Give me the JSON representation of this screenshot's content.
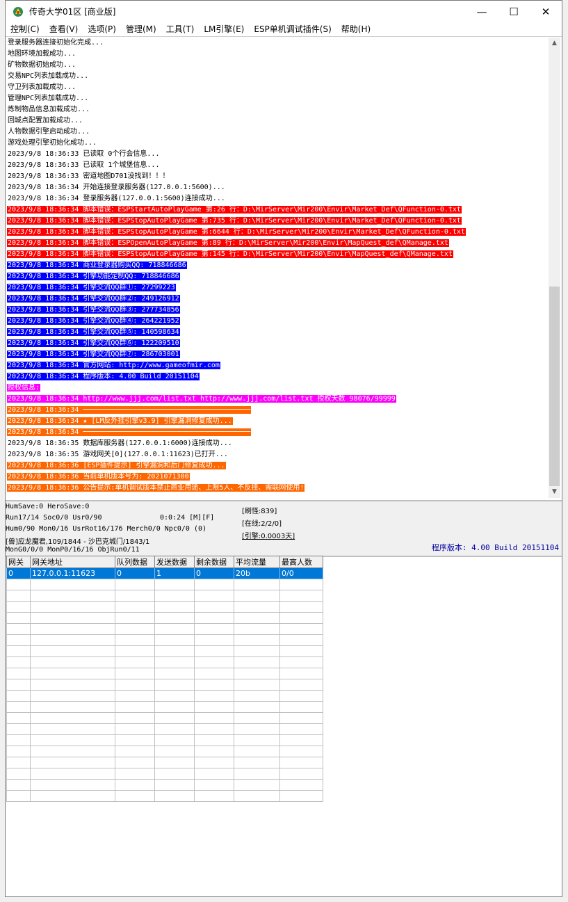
{
  "window": {
    "title": "传奇大学01区 [商业版]",
    "controls": {
      "minimize": "—",
      "maximize": "☐",
      "close": "✕"
    }
  },
  "menu": [
    "控制(C)",
    "查看(V)",
    "选项(P)",
    "管理(M)",
    "工具(T)",
    "LM引擎(E)",
    "ESP单机调试插件(S)",
    "帮助(H)"
  ],
  "log": [
    {
      "text": "登录服务器连接初始化完成...",
      "style": "black"
    },
    {
      "text": "地图环境加载成功...",
      "style": "black"
    },
    {
      "text": "矿物数据初始成功...",
      "style": "black"
    },
    {
      "text": "交易NPC列表加载成功...",
      "style": "black"
    },
    {
      "text": "守卫列表加载成功...",
      "style": "black"
    },
    {
      "text": "管理NPC列表加载成功...",
      "style": "black"
    },
    {
      "text": "炼制物品信息加载成功...",
      "style": "black"
    },
    {
      "text": "回城点配置加载成功...",
      "style": "black"
    },
    {
      "text": "人物数据引擎启动成功...",
      "style": "black"
    },
    {
      "text": "游戏处理引擎初始化成功...",
      "style": "black"
    },
    {
      "text": "2023/9/8 18:36:33 已读取 0个行会信息...",
      "style": "black"
    },
    {
      "text": "2023/9/8 18:36:33 已读取 1个城堡信息...",
      "style": "black"
    },
    {
      "text": "2023/9/8 18:36:33 密道地图D701没找到！！！",
      "style": "black"
    },
    {
      "text": "2023/9/8 18:36:34 开始连接登录服务器(127.0.0.1:5600)...",
      "style": "black"
    },
    {
      "text": "2023/9/8 18:36:34 登录服务器(127.0.0.1:5600)连接成功...",
      "style": "black"
    },
    {
      "text": "2023/9/8 18:36:34 脚本错误：ESPStartAutoPlayGame 第:26 行：D:\\MirServer\\Mir200\\Envir\\Market_Def\\QFunction-0.txt",
      "style": "red"
    },
    {
      "text": "2023/9/8 18:36:34 脚本错误：ESPStopAutoPlayGame 第:735 行：D:\\MirServer\\Mir200\\Envir\\Market_Def\\QFunction-0.txt",
      "style": "red"
    },
    {
      "text": "2023/9/8 18:36:34 脚本错误：ESPStopAutoPlayGame 第:6644 行：D:\\MirServer\\Mir200\\Envir\\Market_Def\\QFunction-0.txt",
      "style": "red"
    },
    {
      "text": "2023/9/8 18:36:34 脚本错误：ESPOpenAutoPlayGame 第:89 行：D:\\MirServer\\Mir200\\Envir\\MapQuest_def\\QManage.txt",
      "style": "red"
    },
    {
      "text": "2023/9/8 18:36:34 脚本错误：ESPStopAutoPlayGame 第:145 行：D:\\MirServer\\Mir200\\Envir\\MapQuest_def\\QManage.txt",
      "style": "red"
    },
    {
      "text": "2023/9/8 18:36:34 商业登录器购买QQ: 718846686",
      "style": "blue"
    },
    {
      "text": "2023/9/8 18:36:34 引擎功能定制QQ: 718846686",
      "style": "blue"
    },
    {
      "text": "2023/9/8 18:36:34 引擎交流QQ群①: 27299223",
      "style": "blue"
    },
    {
      "text": "2023/9/8 18:36:34 引擎交流QQ群②: 249126912",
      "style": "blue"
    },
    {
      "text": "2023/9/8 18:36:34 引擎交流QQ群③: 277734856",
      "style": "blue"
    },
    {
      "text": "2023/9/8 18:36:34 引擎交流QQ群④: 264221952",
      "style": "blue"
    },
    {
      "text": "2023/9/8 18:36:34 引擎交流QQ群⑤: 140598634",
      "style": "blue"
    },
    {
      "text": "2023/9/8 18:36:34 引擎交流QQ群⑥: 122209510",
      "style": "blue"
    },
    {
      "text": "2023/9/8 18:36:34 引擎交流QQ群⑦: 286703001",
      "style": "blue"
    },
    {
      "text": "2023/9/8 18:36:34 官方网站: http://www.gameofmir.com",
      "style": "blue"
    },
    {
      "text": "2023/9/8 18:36:34 程序版本: 4.00 Build 20151104",
      "style": "blue"
    },
    {
      "text": "授权信息:",
      "style": "magenta"
    },
    {
      "text": "2023/9/8 18:36:34 http://www.jjj.com/list.txt http://www.jjj.com/list.txt 授权天数 98076/99999",
      "style": "magenta"
    },
    {
      "text": "2023/9/8 18:36:34 ────────────────────────────────────────",
      "style": "orange"
    },
    {
      "text": "2023/9/8 18:36:34 ★ [LM反外挂引擎v3.9] 引擎漏洞修复成功...",
      "style": "orange"
    },
    {
      "text": "2023/9/8 18:36:34 ────────────────────────────────────────",
      "style": "orange"
    },
    {
      "text": "2023/9/8 18:36:35 数据库服务器(127.0.0.1:6000)连接成功...",
      "style": "black"
    },
    {
      "text": "2023/9/8 18:36:35 游戏网关[0](127.0.0.1:11623)已打开...",
      "style": "black"
    },
    {
      "text": "2023/9/8 18:36:36 [ESP插件提示] 引擎漏洞和后门修复成功...",
      "style": "orange"
    },
    {
      "text": "2023/9/8 18:36:36 当前单机版本号为: 2021071300",
      "style": "orange"
    },
    {
      "text": "2023/9/8 18:36:36 公告提示:单机调试版本禁止商业用途、上限5人、不反挂、需联网使用!",
      "style": "orange"
    }
  ],
  "status": {
    "line1": "HumSave:0 HeroSave:0",
    "line2": "Run17/14 Soc0/0 Usr0/90",
    "time": "0:0:24 [M][F]",
    "line3": "Hum0/90 Mon0/16 UsrRot16/176 Merch0/0 Npc0/0 (0)",
    "line4": "[兽]应龙魔君,109/1844 - 沙巴克城门/1843/1",
    "line5": "MonG0/0/0 MonP0/16/16 ObjRun0/11",
    "refresh": "[刷怪:839]",
    "online": "[在线:2/2/0]",
    "engine": "[引擎:0.0003天]",
    "version": "程序版本: 4.00 Build 20151104"
  },
  "gateway_table": {
    "columns": [
      "网关",
      "网关地址",
      "队列数据",
      "发送数据",
      "剩余数据",
      "平均流量",
      "最高人数"
    ],
    "rows": [
      [
        "0",
        "127.0.0.1:11623",
        "0",
        "1",
        "0",
        "20b",
        "0/0"
      ]
    ],
    "empty_rows": 20
  }
}
